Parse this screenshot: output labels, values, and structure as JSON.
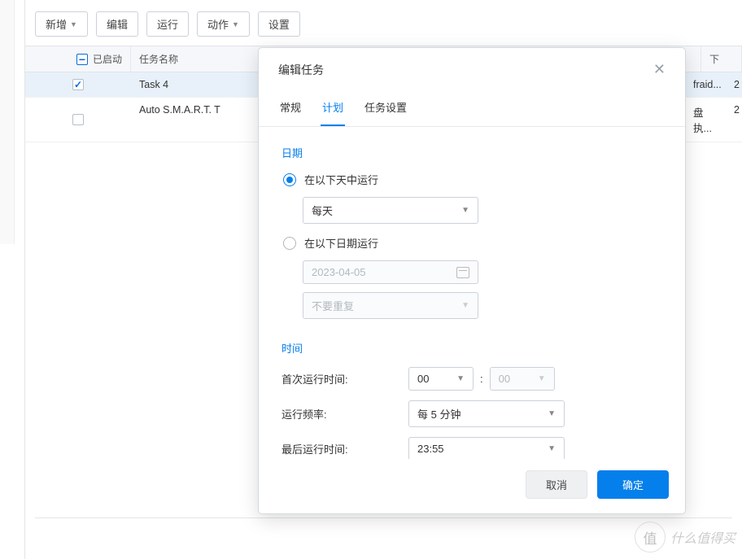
{
  "toolbar": {
    "new": "新增",
    "edit": "编辑",
    "run": "运行",
    "action": "动作",
    "settings_partial": "设置"
  },
  "table": {
    "col_enabled": "已启动",
    "col_name": "任务名称",
    "col_right_header": "下",
    "rows": [
      {
        "enabled": true,
        "name": "Task 4",
        "right": "fraid...",
        "n": "2"
      },
      {
        "enabled": false,
        "name": "Auto S.M.A.R.T. T",
        "right": "盘执...",
        "n": "2"
      }
    ]
  },
  "modal": {
    "title": "编辑任务",
    "tabs": {
      "general": "常规",
      "schedule": "计划",
      "task_settings": "任务设置"
    },
    "date_section": "日期",
    "radio_run_days": "在以下天中运行",
    "every_day": "每天",
    "radio_run_date": "在以下日期运行",
    "date_value": "2023-04-05",
    "repeat_value": "不要重复",
    "time_section": "时间",
    "first_run_label": "首次运行时间:",
    "first_run_hour": "00",
    "first_run_min": "00",
    "freq_label": "运行频率:",
    "freq_value": "每 5 分钟",
    "last_run_label": "最后运行时间:",
    "last_run_value": "23:55",
    "cancel": "取消",
    "ok": "确定"
  },
  "watermark": {
    "badge": "值",
    "text": "什么值得买"
  }
}
